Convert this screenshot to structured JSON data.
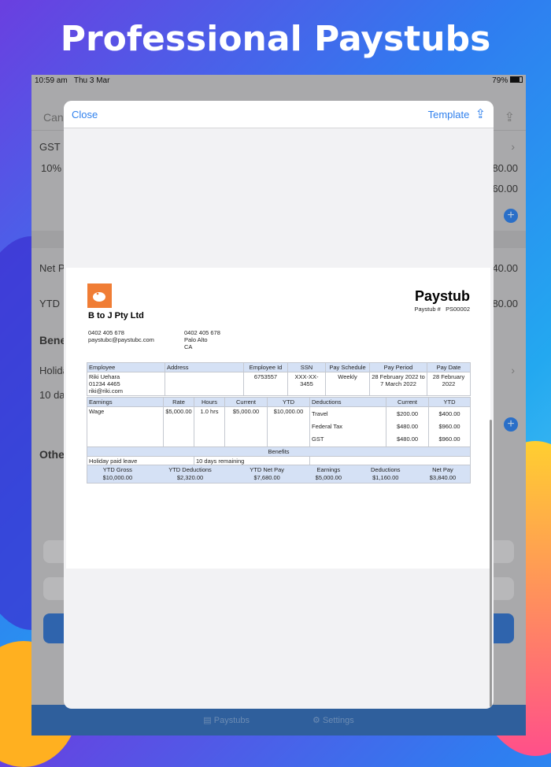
{
  "headline": "Professional Paystubs",
  "status": {
    "time": "10:59 am",
    "date": "Thu 3 Mar",
    "battery": "79%"
  },
  "background": {
    "cancel": "Canc",
    "gst": "GST",
    "gst_rate": "10%",
    "v1": "80.00",
    "v2": "60.00",
    "net_pay": "Net Pa",
    "v3": "40.00",
    "ytd": "YTD",
    "v4": "80.00",
    "benefits": "Bene",
    "holiday": "Holida",
    "days": "10 day",
    "other": "Othe"
  },
  "tabs": [
    {
      "label": "Paystubs"
    },
    {
      "label": "Settings"
    }
  ],
  "modal": {
    "close": "Close",
    "template": "Template"
  },
  "paystub": {
    "company": "B to J Pty Ltd",
    "company_phone": "0402 405 678",
    "company_email": "paystubc@paystubc.com",
    "addr_phone": "0402 405 678",
    "addr_city": "Palo Alto",
    "addr_state": "CA",
    "title": "Paystub",
    "number_label": "Paystub #",
    "number": "PS00002",
    "info_headers": [
      "Employee",
      "Address",
      "Employee Id",
      "SSN",
      "Pay Schedule",
      "Pay Period",
      "Pay Date"
    ],
    "employee_name": "Riki Uehara",
    "employee_phone": "01234 4465",
    "employee_email": "riki@riki.com",
    "employee_id": "6753557",
    "ssn": "XXX-XX-3455",
    "schedule": "Weekly",
    "period": "28 February 2022 to 7 March 2022",
    "pay_date": "28 February 2022",
    "earn_headers": [
      "Earnings",
      "Rate",
      "Hours",
      "Current",
      "YTD",
      "Deductions",
      "Current",
      "YTD"
    ],
    "earning": {
      "name": "Wage",
      "rate": "$5,000.00",
      "hours": "1.0 hrs",
      "current": "$5,000.00",
      "ytd": "$10,000.00"
    },
    "deductions": [
      {
        "name": "Travel",
        "current": "$200.00",
        "ytd": "$400.00"
      },
      {
        "name": "Federal Tax",
        "current": "$480.00",
        "ytd": "$960.00"
      },
      {
        "name": "GST",
        "current": "$480.00",
        "ytd": "$960.00"
      }
    ],
    "benefits_label": "Benefits",
    "benefit": {
      "name": "Holiday paid leave",
      "value": "10 days remaining"
    },
    "summary": [
      {
        "label": "YTD Gross",
        "value": "$10,000.00"
      },
      {
        "label": "YTD Deductions",
        "value": "$2,320.00"
      },
      {
        "label": "YTD Net Pay",
        "value": "$7,680.00"
      },
      {
        "label": "Earnings",
        "value": "$5,000.00"
      },
      {
        "label": "Deductions",
        "value": "$1,160.00"
      },
      {
        "label": "Net Pay",
        "value": "$3,840.00"
      }
    ]
  }
}
